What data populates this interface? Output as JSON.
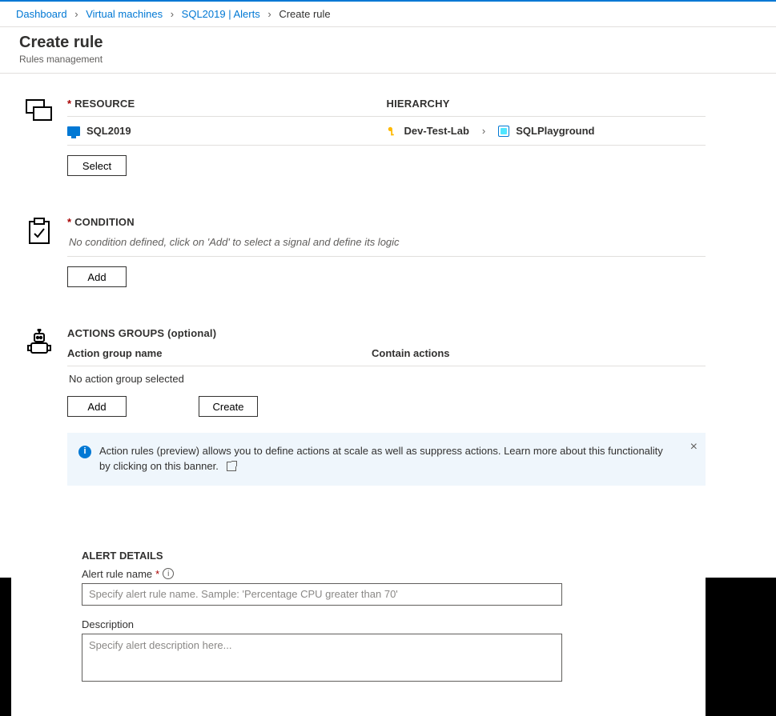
{
  "breadcrumb": {
    "items": [
      "Dashboard",
      "Virtual machines",
      "SQL2019 | Alerts"
    ],
    "current": "Create rule"
  },
  "header": {
    "title": "Create rule",
    "subtitle": "Rules management"
  },
  "resource": {
    "heading": "RESOURCE",
    "hierarchy_heading": "HIERARCHY",
    "name": "SQL2019",
    "hier_a": "Dev-Test-Lab",
    "hier_b": "SQLPlayground",
    "select_btn": "Select"
  },
  "condition": {
    "heading": "CONDITION",
    "hint": "No condition defined, click on 'Add' to select a signal and define its logic",
    "add_btn": "Add"
  },
  "action_groups": {
    "heading": "ACTIONS GROUPS (optional)",
    "col1": "Action group name",
    "col2": "Contain actions",
    "none": "No action group selected",
    "add_btn": "Add",
    "create_btn": "Create",
    "banner": "Action rules (preview) allows you to define actions at scale as well as suppress actions. Learn more about this functionality by clicking on this banner."
  },
  "alert_details": {
    "heading": "ALERT DETAILS",
    "name_label": "Alert rule name",
    "name_placeholder": "Specify alert rule name. Sample: 'Percentage CPU greater than 70'",
    "desc_label": "Description",
    "desc_placeholder": "Specify alert description here..."
  }
}
